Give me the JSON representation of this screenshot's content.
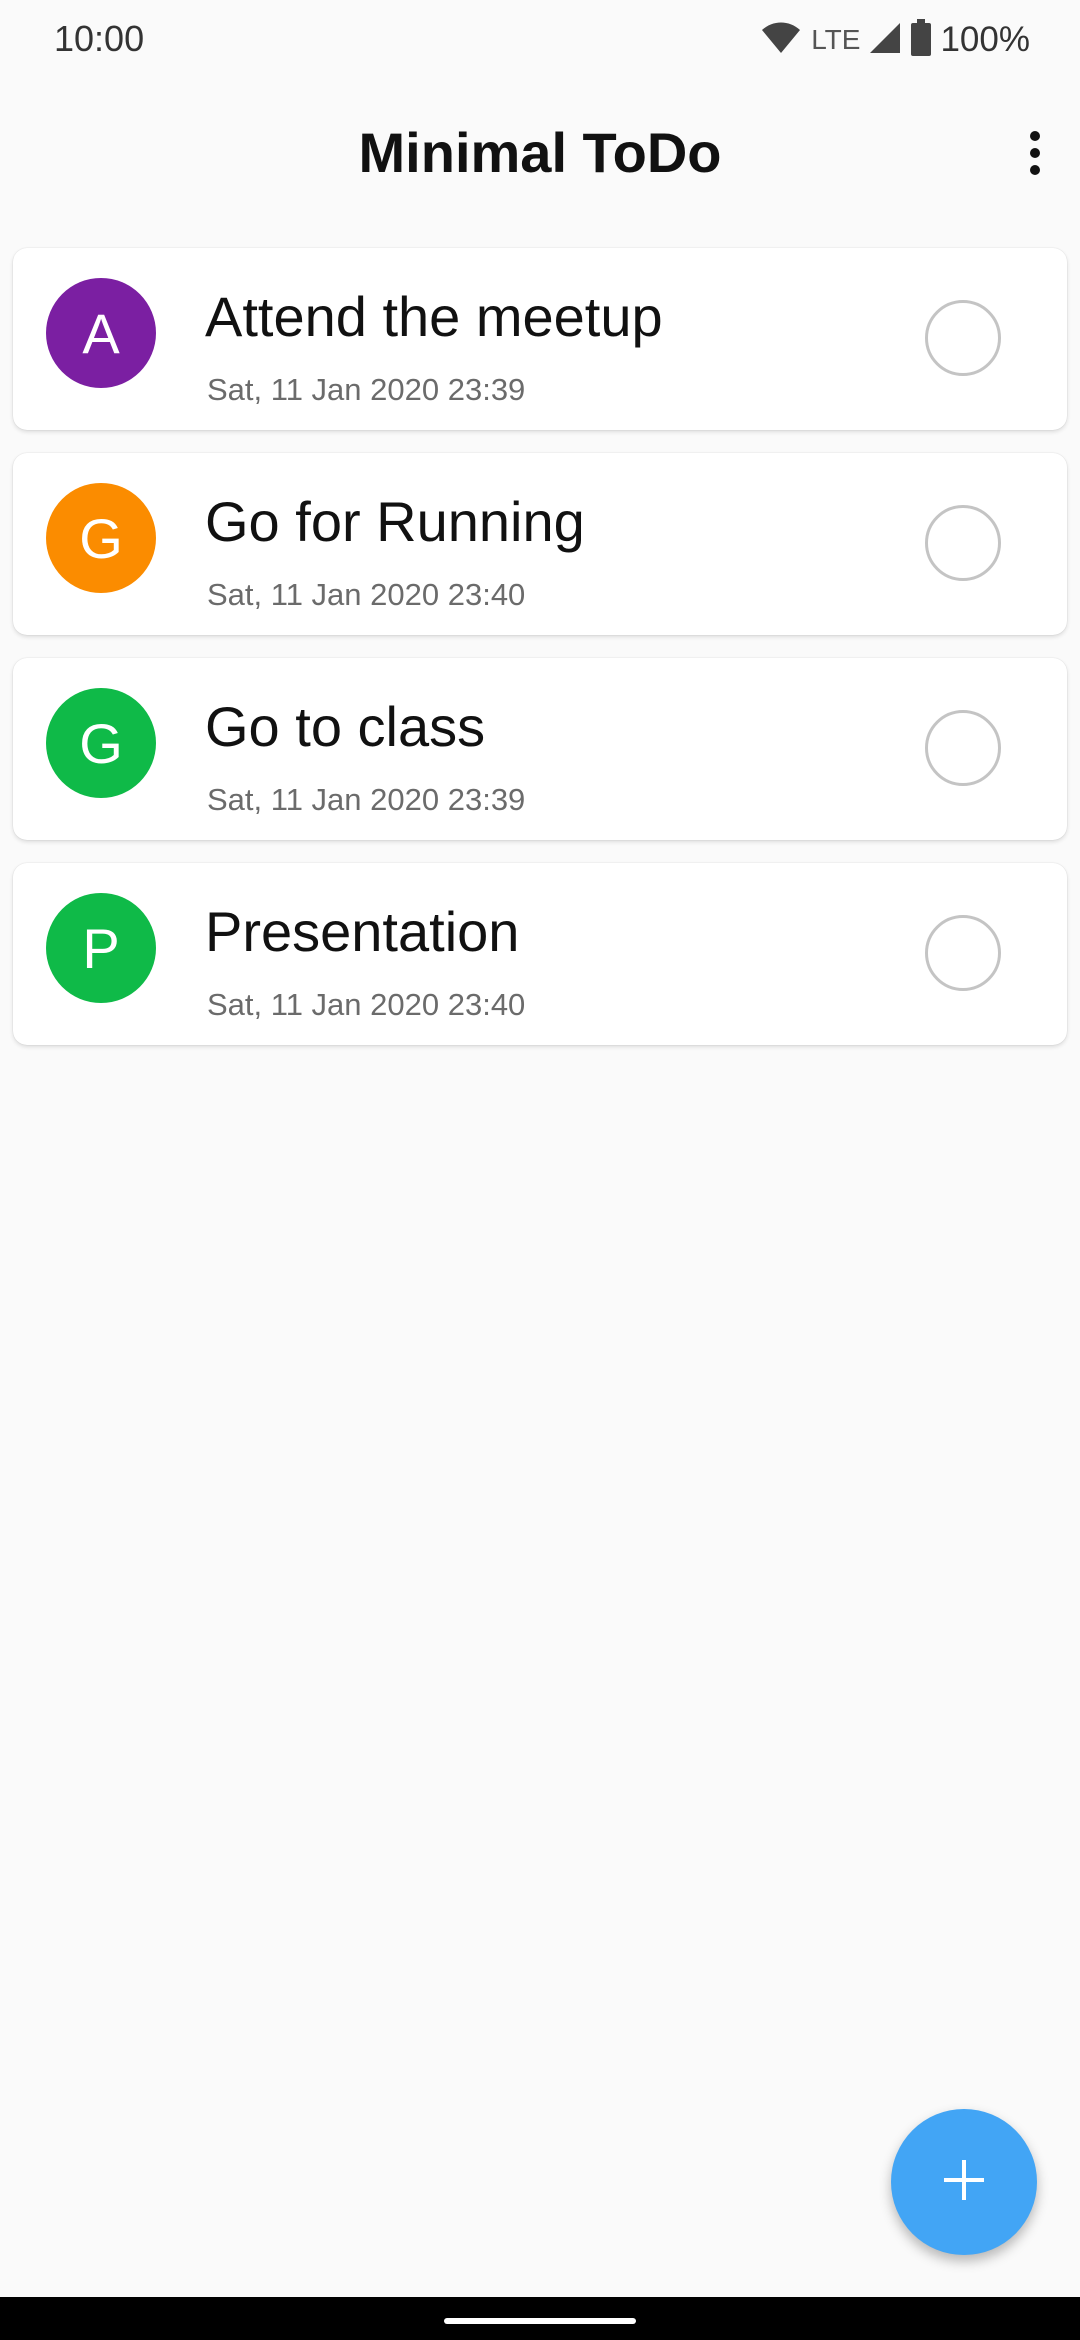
{
  "status_bar": {
    "time": "10:00",
    "network": "LTE",
    "battery": "100%",
    "icons": [
      "wifi-icon",
      "cell-signal-icon",
      "battery-icon"
    ]
  },
  "app_bar": {
    "title": "Minimal ToDo",
    "menu_icon": "more-vert-icon"
  },
  "todos": [
    {
      "initial": "A",
      "title": "Attend the meetup",
      "date": "Sat, 11 Jan 2020 23:39",
      "color": "#7b1fa2",
      "completed": false
    },
    {
      "initial": "G",
      "title": "Go for Running",
      "date": "Sat, 11 Jan 2020 23:40",
      "color": "#fb8c00",
      "completed": false
    },
    {
      "initial": "G",
      "title": "Go to class",
      "date": "Sat, 11 Jan 2020 23:39",
      "color": "#0fba48",
      "completed": false
    },
    {
      "initial": "P",
      "title": "Presentation",
      "date": "Sat, 11 Jan 2020 23:40",
      "color": "#0fba48",
      "completed": false
    }
  ],
  "fab": {
    "icon": "add-icon",
    "color": "#42a5f5"
  }
}
